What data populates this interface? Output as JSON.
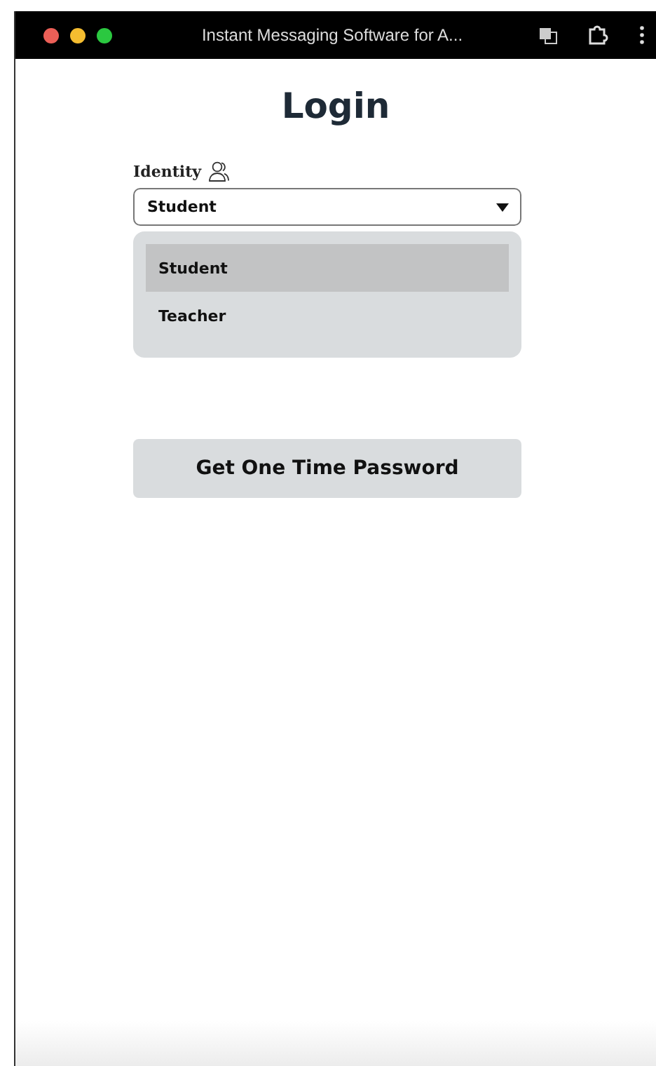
{
  "window": {
    "title": "Instant Messaging Software for A..."
  },
  "heading": "Login",
  "identity": {
    "label": "Identity",
    "value": "Student",
    "expanded": true,
    "options": [
      {
        "label": "Student",
        "selected": true
      },
      {
        "label": "Teacher",
        "selected": false
      }
    ]
  },
  "otp_button": "Get One Time Password"
}
